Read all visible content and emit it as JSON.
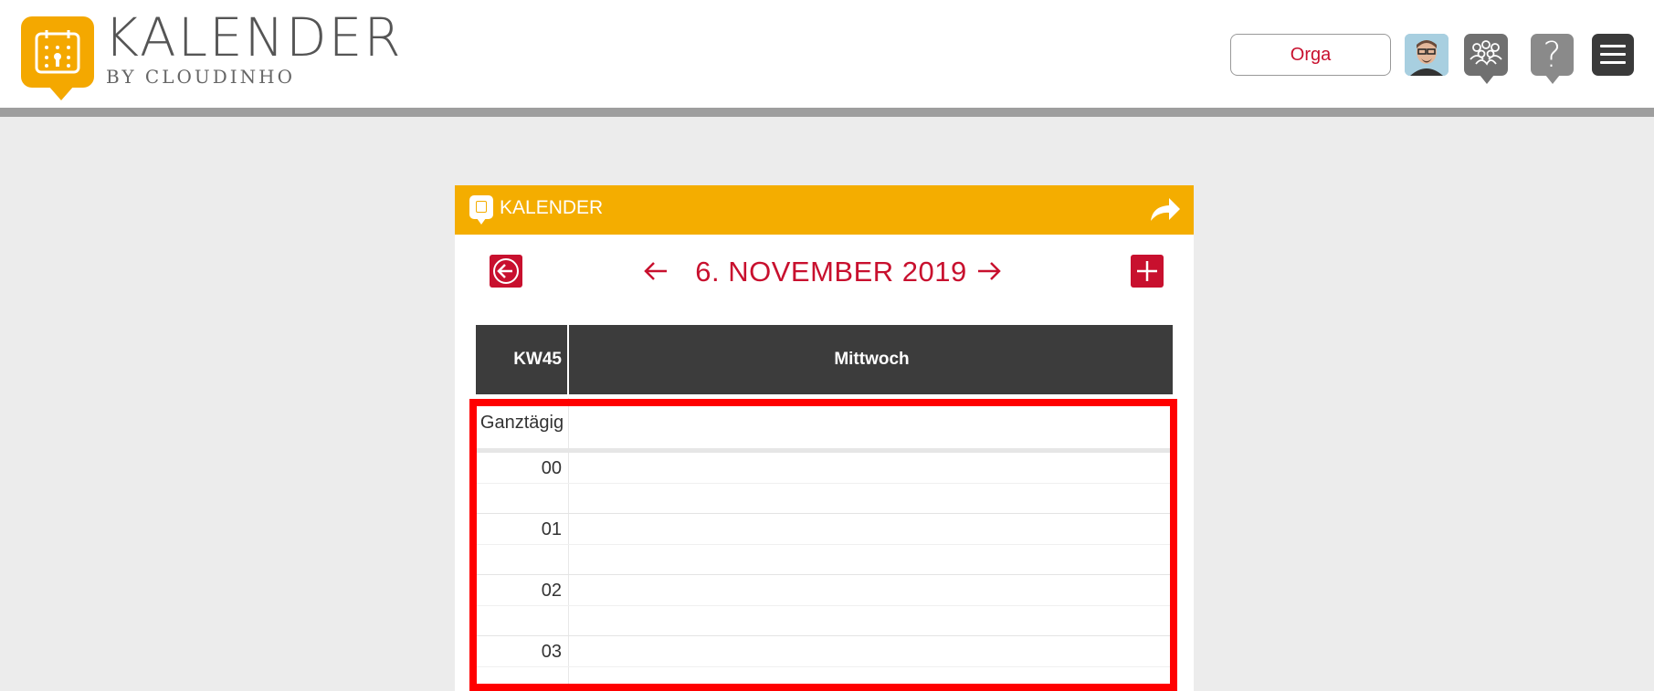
{
  "header": {
    "brand_title": "KALENDER",
    "brand_subtitle": "BY CLOUDINHO",
    "orga_label": "Orga",
    "icons": [
      "calendar-logo-icon",
      "avatar",
      "team-icon",
      "help-icon",
      "menu-icon"
    ]
  },
  "calendar": {
    "title": "KALENDER",
    "date": "6. NOVEMBER 2019",
    "week": "KW45",
    "day": "Mittwoch",
    "allday_label": "Ganztägig",
    "hours": [
      "00",
      "01",
      "02",
      "03"
    ]
  },
  "colors": {
    "accent": "#f4ad00",
    "red": "#c8102e",
    "header_dark": "#3c3c3c",
    "highlight": "#ff0000"
  }
}
